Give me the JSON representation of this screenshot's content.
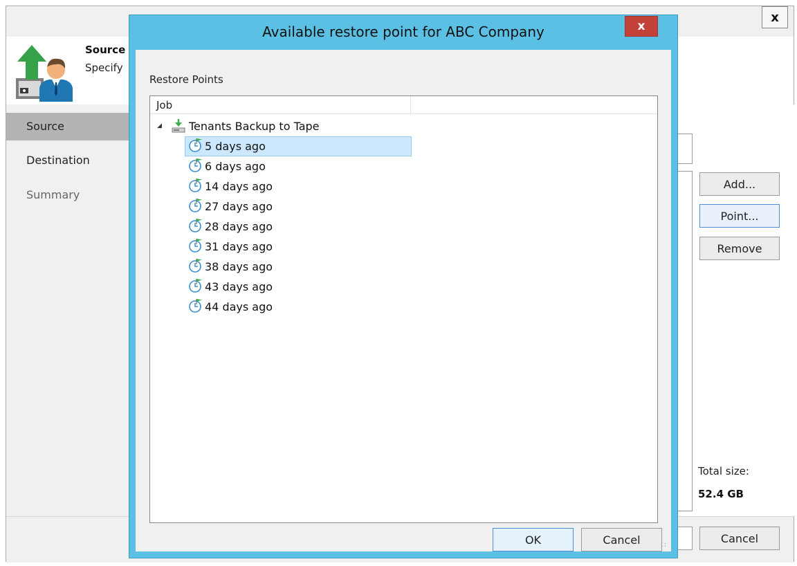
{
  "wizard": {
    "close_label": "x",
    "header_title": "Source",
    "header_subtitle": "Specify",
    "steps": [
      {
        "label": "Source"
      },
      {
        "label": "Destination"
      },
      {
        "label": "Summary"
      }
    ],
    "buttons": {
      "add": "Add...",
      "point": "Point...",
      "remove": "Remove",
      "cancel": "Cancel"
    },
    "total_size_label": "Total size:",
    "total_size_value": "52.4 GB"
  },
  "dialog": {
    "title": "Available restore point for ABC Company",
    "close_label": "x",
    "section_label": "Restore Points",
    "column_job": "Job",
    "job_name": "Tenants Backup to Tape",
    "restore_points": [
      {
        "label": "5 days ago",
        "selected": true
      },
      {
        "label": "6 days ago"
      },
      {
        "label": "14 days ago"
      },
      {
        "label": "27 days ago"
      },
      {
        "label": "28 days ago"
      },
      {
        "label": "31 days ago"
      },
      {
        "label": "38 days ago"
      },
      {
        "label": "43 days ago"
      },
      {
        "label": "44 days ago"
      }
    ],
    "ok_label": "OK",
    "cancel_label": "Cancel"
  },
  "colors": {
    "dialog_frame": "#5bc0e4",
    "close_red": "#c4413a",
    "selection": "#cce8ff",
    "restore_point_green": "#3fae49"
  }
}
